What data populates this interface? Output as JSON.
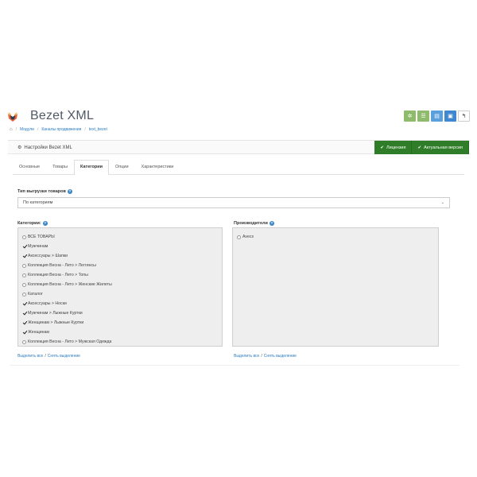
{
  "header": {
    "app_title": "Bezet XML",
    "buttons": [
      {
        "name": "settings",
        "glyph": "✲"
      },
      {
        "name": "list",
        "glyph": "☰"
      },
      {
        "name": "copy",
        "glyph": "▤"
      },
      {
        "name": "save",
        "glyph": "▣"
      },
      {
        "name": "back",
        "glyph": "↰"
      }
    ],
    "colors": {
      "green_btn": "#8fbb6c",
      "blue_btn": "#5aa0dd",
      "save_btn": "#3f88cf"
    }
  },
  "breadcrumb": {
    "home_icon": "home-icon",
    "items": [
      "Модули",
      "Каналы продвижения",
      "text_bezet"
    ]
  },
  "panel": {
    "title": "Настройки Bezet XML",
    "license_label": "Лицензия",
    "version_label": "Актуальная версия",
    "status_color": "#2f7d28"
  },
  "tabs": [
    {
      "label": "Основные",
      "active": false
    },
    {
      "label": "Товары",
      "active": false
    },
    {
      "label": "Категории",
      "active": true
    },
    {
      "label": "Опции",
      "active": false
    },
    {
      "label": "Характеристики",
      "active": false
    }
  ],
  "export_type": {
    "label": "Тип выгрузки товаров",
    "value": "По категориям"
  },
  "categories": {
    "label": "Категории:",
    "items": [
      {
        "label": "ВСЕ ТОВАРЫ",
        "checked": false
      },
      {
        "label": "Мужчинам",
        "checked": true
      },
      {
        "label": "Аксессуары  >  Шапки",
        "checked": true
      },
      {
        "label": "Коллекция Весна - Лето  >  Леггинсы",
        "checked": false
      },
      {
        "label": "Коллекция Весна - Лето  >  Топы",
        "checked": false
      },
      {
        "label": "Коллекция Весна - Лето  >  Женские Жилеты",
        "checked": false
      },
      {
        "label": "Каталог",
        "checked": false
      },
      {
        "label": "Аксессуары  >  Носки",
        "checked": true
      },
      {
        "label": "Мужчинам  >  Лыжные Куртки",
        "checked": true
      },
      {
        "label": "Женщинам  >  Лыжные Куртки",
        "checked": true
      },
      {
        "label": "Женщинам",
        "checked": true
      },
      {
        "label": "Коллекция Весна - Лето  >  Мужская Одежда",
        "checked": false
      }
    ],
    "select_all": "Выделить все",
    "deselect": "Снять выделение"
  },
  "manufacturers": {
    "label": "Производители",
    "items": [
      {
        "label": "Avecs",
        "checked": false
      }
    ],
    "select_all": "Выделить все",
    "deselect": "Снять выделение"
  }
}
